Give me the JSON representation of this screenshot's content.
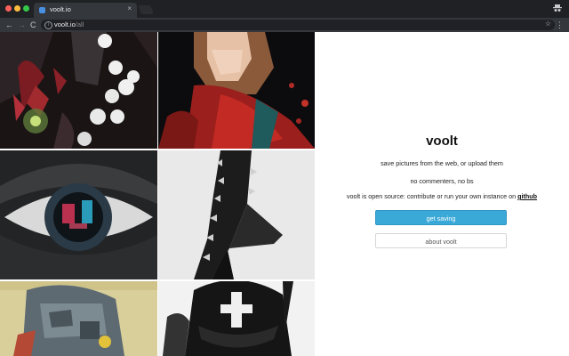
{
  "browser": {
    "tab_title": "voolt.io",
    "tab_close": "×",
    "url_host": "voolt.io",
    "url_path": "/all",
    "back_glyph": "←",
    "forward_glyph": "→",
    "reload_glyph": "C",
    "star_glyph": "☆",
    "menu_glyph": "⋮",
    "info_glyph": "i"
  },
  "panel": {
    "brand": "voolt",
    "tagline": "save pictures from the web, or upload them",
    "no_comments": "no commenters, no bs",
    "open_source_prefix": "voolt is open source: contribute or run your own instance on",
    "github_link": "github",
    "primary_button": "get saving",
    "secondary_button": "about voolt"
  },
  "gallery": {
    "images": [
      {
        "name": "illustration-ghosts-dark"
      },
      {
        "name": "illustration-red-jacket"
      },
      {
        "name": "eye-closeup"
      },
      {
        "name": "spiked-boot"
      },
      {
        "name": "cyber-helmet"
      },
      {
        "name": "ink-masked-figure"
      }
    ]
  },
  "colors": {
    "chrome_dark": "#1f2124",
    "chrome_toolbar": "#34373b",
    "accent_button": "#3aa9d8"
  }
}
